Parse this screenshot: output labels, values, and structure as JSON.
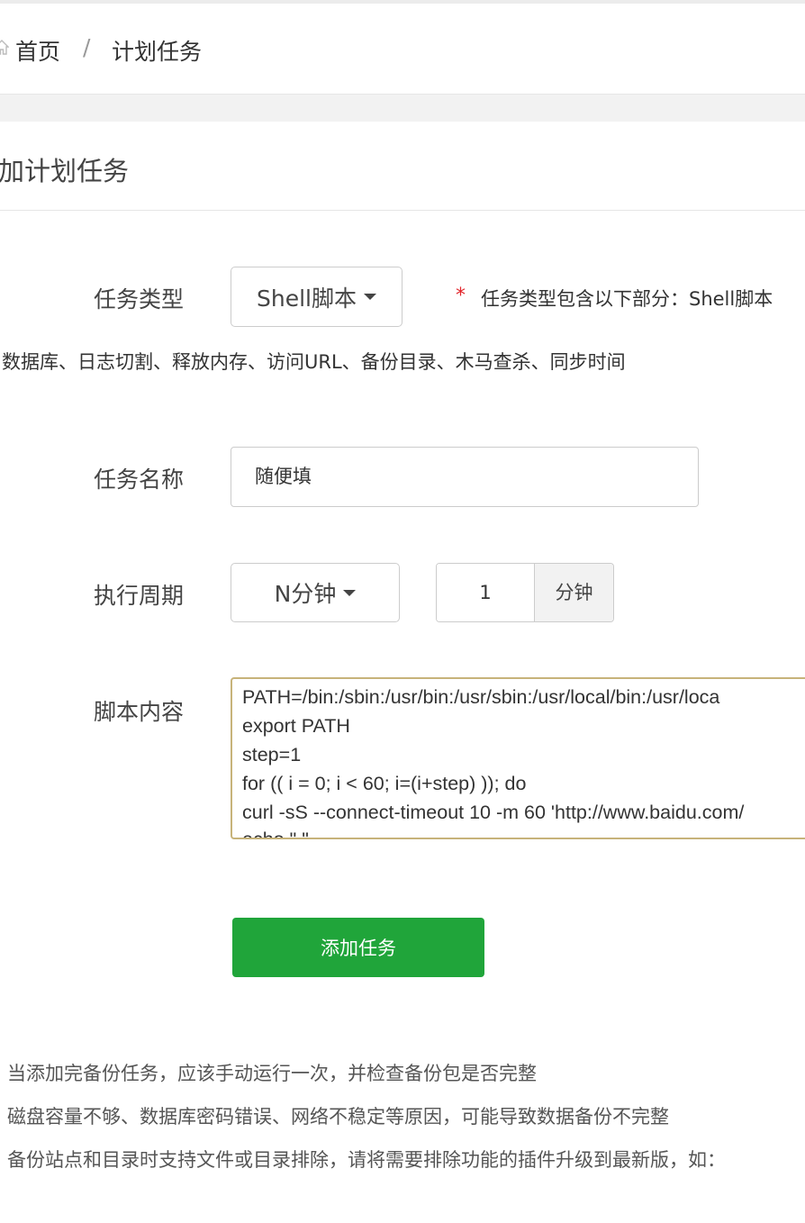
{
  "breadcrumb": {
    "home": "首页",
    "separator": "/",
    "current": "计划任务"
  },
  "panel": {
    "title": "加计划任务"
  },
  "form": {
    "task_type": {
      "label": "任务类型",
      "selected": "Shell脚本",
      "required_mark": "*",
      "hint_line1": "任务类型包含以下部分：Shell脚本",
      "hint_line2": "数据库、日志切割、释放内存、访问URL、备份目录、木马查杀、同步时间"
    },
    "task_name": {
      "label": "任务名称",
      "value": "随便填"
    },
    "period": {
      "label": "执行周期",
      "selected": "N分钟",
      "value": "1",
      "unit": "分钟"
    },
    "script": {
      "label": "脚本内容",
      "lines": [
        "PATH=/bin:/sbin:/usr/bin:/usr/sbin:/usr/local/bin:/usr/loca",
        "export PATH",
        "step=1",
        "for (( i = 0; i < 60; i=(i+step) )); do",
        "curl -sS --connect-timeout 10 -m 60 'http://www.baidu.com/",
        "echo \"                                                      \""
      ]
    },
    "submit_label": "添加任务"
  },
  "notes": [
    "当添加完备份任务，应该手动运行一次，并检查备份包是否完整",
    "磁盘容量不够、数据库密码错误、网络不稳定等原因，可能导致数据备份不完整",
    "备份站点和目录时支持文件或目录排除，请将需要排除功能的插件升级到最新版，如："
  ],
  "colors": {
    "primary": "#20a53a",
    "required": "#e2252b",
    "focus_border": "#c7b37a"
  },
  "icons": {
    "home": "home-icon",
    "caret": "caret-down-icon"
  }
}
